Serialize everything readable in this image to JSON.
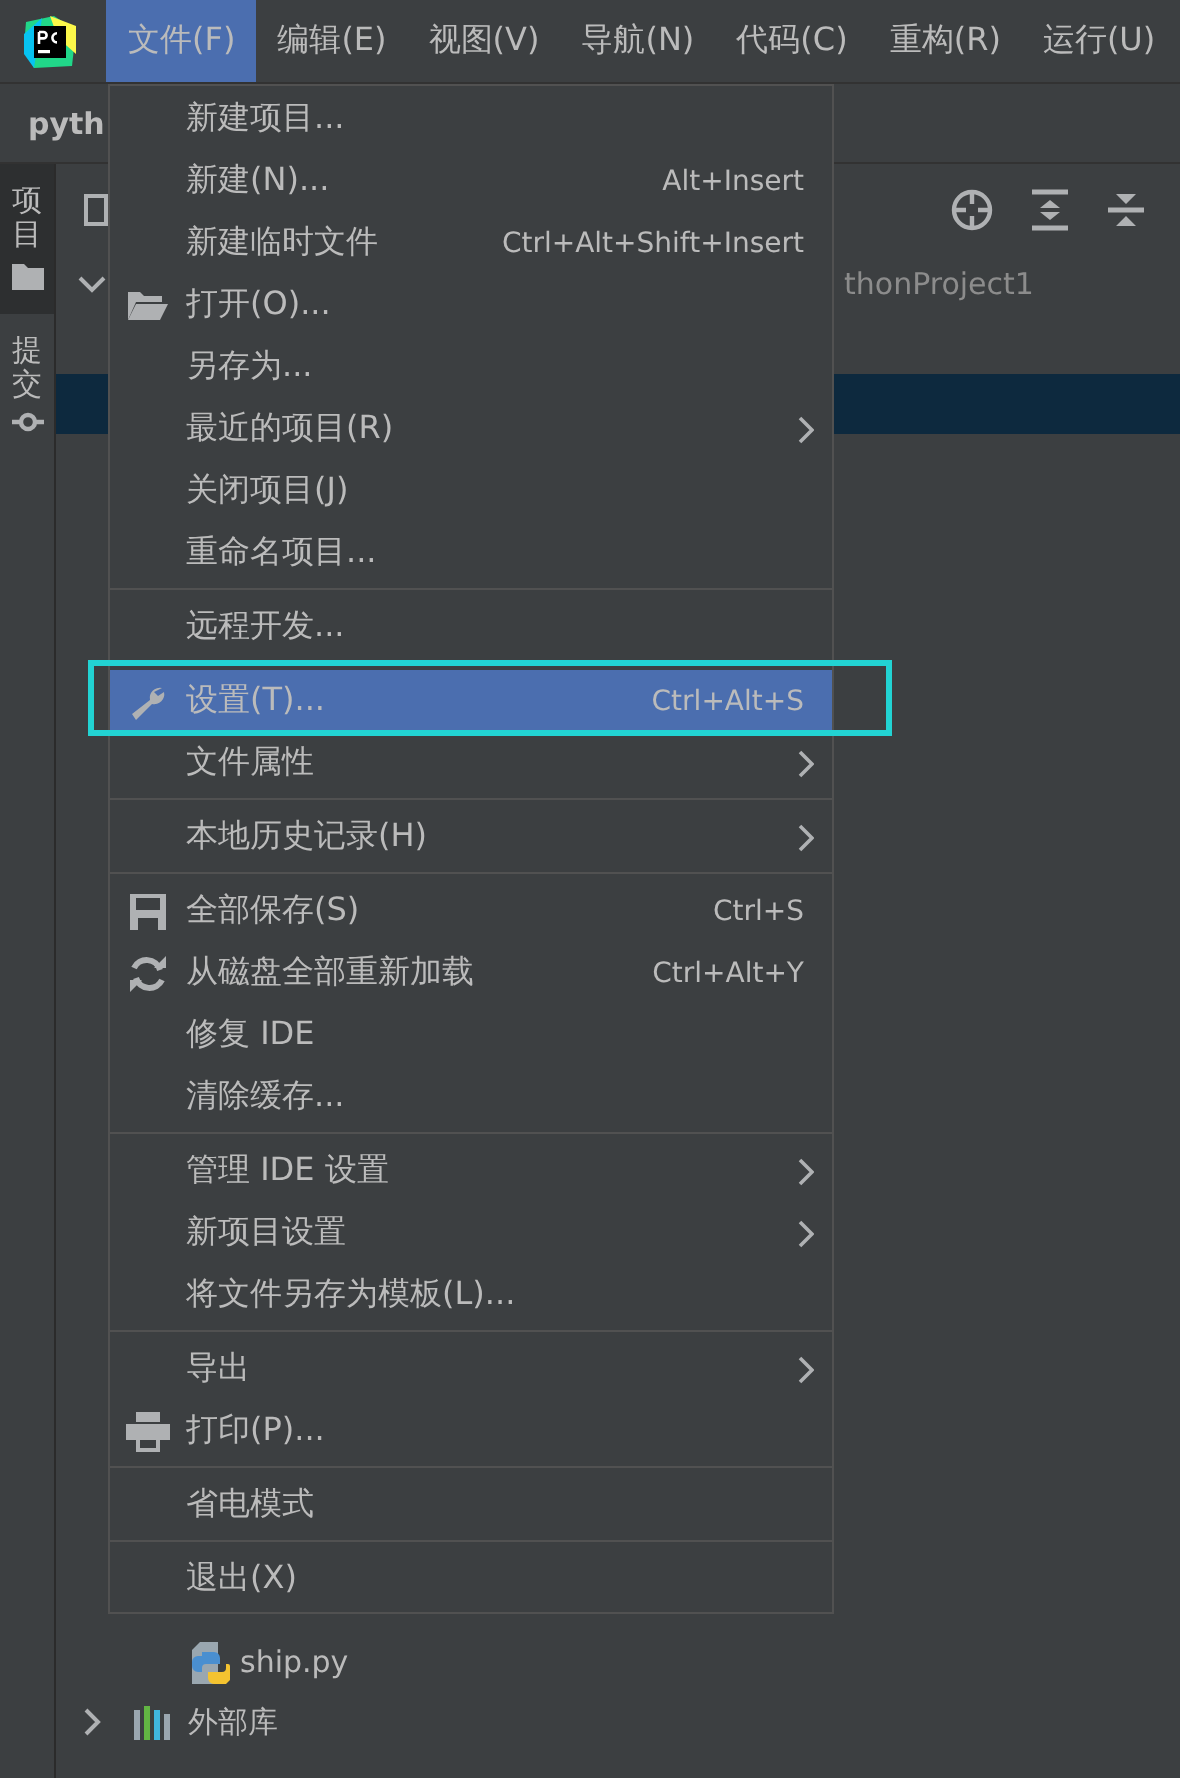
{
  "menubar": [
    {
      "label": "文件(F)",
      "selected": true
    },
    {
      "label": "编辑(E)",
      "selected": false
    },
    {
      "label": "视图(V)",
      "selected": false
    },
    {
      "label": "导航(N)",
      "selected": false
    },
    {
      "label": "代码(C)",
      "selected": false
    },
    {
      "label": "重构(R)",
      "selected": false
    },
    {
      "label": "运行(U)",
      "selected": false
    }
  ],
  "breadcrumb": "pyth",
  "tool_strip": [
    {
      "label": "项目",
      "selected": true
    },
    {
      "label": "提交",
      "selected": false
    }
  ],
  "tree": [
    {
      "label": "thonProject1",
      "expanded": true,
      "selected": false,
      "children": [
        {
          "selected": true
        },
        {
          "label": "ship.py",
          "selected": false
        }
      ]
    },
    {
      "label": "外部库",
      "expanded": false,
      "selected": false
    }
  ],
  "file_menu": {
    "groups": [
      [
        {
          "label": "新建项目...",
          "selected": false
        },
        {
          "label": "新建(N)...",
          "shortcut": "Alt+Insert",
          "selected": false
        },
        {
          "label": "新建临时文件",
          "shortcut": "Ctrl+Alt+Shift+Insert",
          "selected": false
        },
        {
          "label": "打开(O)...",
          "selected": false
        },
        {
          "label": "另存为...",
          "selected": false
        },
        {
          "label": "最近的项目(R)",
          "submenu": true,
          "selected": false
        },
        {
          "label": "关闭项目(J)",
          "selected": false
        },
        {
          "label": "重命名项目...",
          "selected": false
        }
      ],
      [
        {
          "label": "远程开发...",
          "selected": false
        }
      ],
      [
        {
          "label": "设置(T)...",
          "shortcut": "Ctrl+Alt+S",
          "selected": true,
          "highlighted": true
        },
        {
          "label": "文件属性",
          "submenu": true,
          "selected": false
        }
      ],
      [
        {
          "label": "本地历史记录(H)",
          "submenu": true,
          "selected": false
        }
      ],
      [
        {
          "label": "全部保存(S)",
          "shortcut": "Ctrl+S",
          "selected": false
        },
        {
          "label": "从磁盘全部重新加载",
          "shortcut": "Ctrl+Alt+Y",
          "selected": false
        },
        {
          "label": "修复 IDE",
          "selected": false
        },
        {
          "label": "清除缓存...",
          "selected": false
        }
      ],
      [
        {
          "label": "管理 IDE 设置",
          "submenu": true,
          "selected": false
        },
        {
          "label": "新项目设置",
          "submenu": true,
          "selected": false
        },
        {
          "label": "将文件另存为模板(L)...",
          "selected": false
        }
      ],
      [
        {
          "label": "导出",
          "submenu": true,
          "selected": false
        },
        {
          "label": "打印(P)...",
          "selected": false
        }
      ],
      [
        {
          "label": "省电模式",
          "selected": false
        }
      ],
      [
        {
          "label": "退出(X)",
          "selected": false
        }
      ]
    ]
  }
}
